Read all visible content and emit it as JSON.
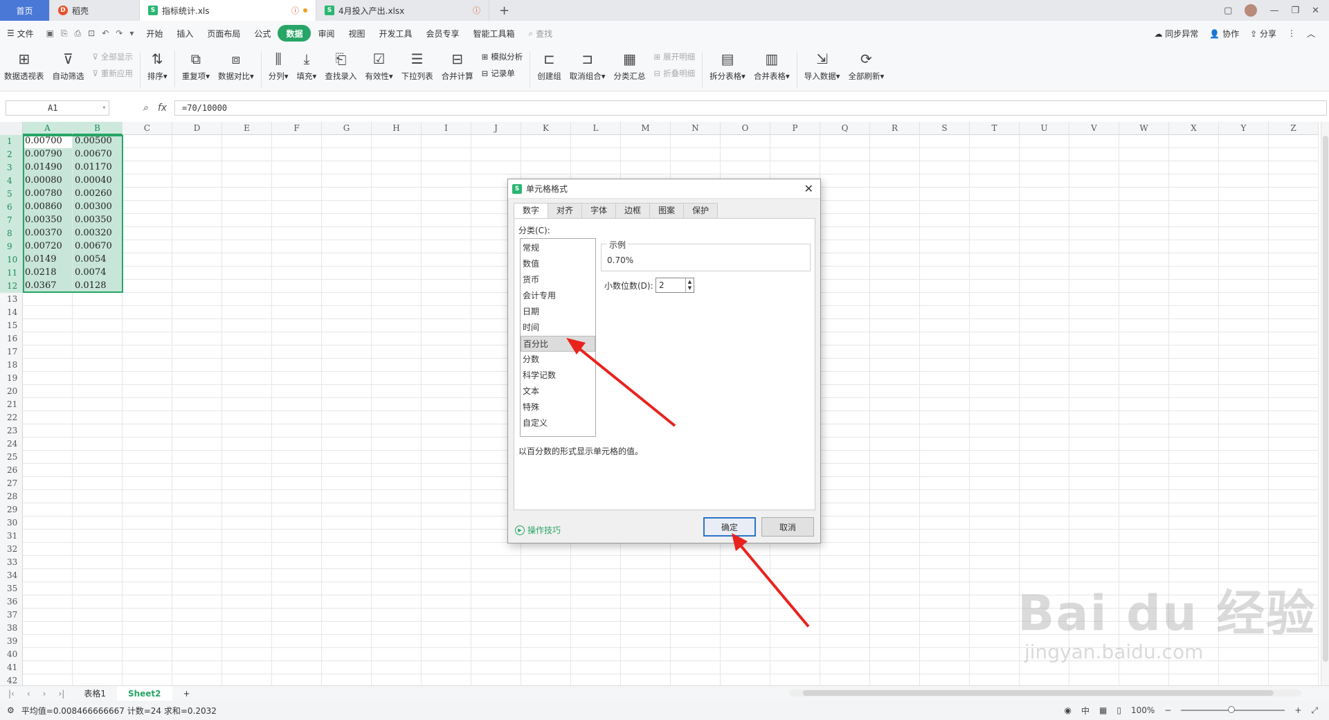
{
  "tabs": [
    {
      "label": "首页"
    },
    {
      "label": "稻壳"
    },
    {
      "label": "指标统计.xls"
    },
    {
      "label": "4月投入产出.xlsx"
    }
  ],
  "menu": {
    "file": "文件",
    "items": [
      "开始",
      "插入",
      "页面布局",
      "公式",
      "数据",
      "审阅",
      "视图",
      "开发工具",
      "会员专享",
      "智能工具箱"
    ],
    "search": "查找",
    "right": [
      "同步异常",
      "协作",
      "分享"
    ]
  },
  "ribbon": {
    "pivot": "数据透视表",
    "autofilter": "自动筛选",
    "showall": "全部显示",
    "reapply": "重新应用",
    "sort": "排序",
    "dup": "重复项",
    "compare": "数据对比",
    "split": "分列",
    "fill": "填充",
    "lookup": "查找录入",
    "validity": "有效性",
    "dropdown": "下拉列表",
    "merge_calc": "合并计算",
    "whatif": "模拟分析",
    "record": "记录单",
    "group": "创建组",
    "ungroup": "取消组合",
    "subtotal": "分类汇总",
    "expand": "展开明细",
    "collapse": "折叠明细",
    "split_table": "拆分表格",
    "merge_table": "合并表格",
    "import": "导入数据",
    "refresh": "全部刷新"
  },
  "formula_bar": {
    "name_box": "A1",
    "fx": "fx",
    "formula": "=70/10000"
  },
  "columns": [
    "A",
    "B",
    "C",
    "D",
    "E",
    "F",
    "G",
    "H",
    "I",
    "J",
    "K",
    "L",
    "M",
    "N",
    "O",
    "P",
    "Q",
    "R",
    "S",
    "T",
    "U",
    "V",
    "W",
    "X",
    "Y",
    "Z"
  ],
  "rows": [
    [
      "0.00700",
      "0.00500"
    ],
    [
      "0.00790",
      "0.00670"
    ],
    [
      "0.01490",
      "0.01170"
    ],
    [
      "0.00080",
      "0.00040"
    ],
    [
      "0.00780",
      "0.00260"
    ],
    [
      "0.00860",
      "0.00300"
    ],
    [
      "0.00350",
      "0.00350"
    ],
    [
      "0.00370",
      "0.00320"
    ],
    [
      "0.00720",
      "0.00670"
    ],
    [
      "0.0149",
      "0.0054"
    ],
    [
      "0.0218",
      "0.0074"
    ],
    [
      "0.0367",
      "0.0128"
    ]
  ],
  "row_count": 42,
  "sheets": [
    "表格1",
    "Sheet2"
  ],
  "status": {
    "text": "平均值=0.008466666667  计数=24  求和=0.2032",
    "zoom": "100%"
  },
  "dialog": {
    "title": "单元格格式",
    "tabs": [
      "数字",
      "对齐",
      "字体",
      "边框",
      "图案",
      "保护"
    ],
    "category_label": "分类(C):",
    "categories": [
      "常规",
      "数值",
      "货币",
      "会计专用",
      "日期",
      "时间",
      "百分比",
      "分数",
      "科学记数",
      "文本",
      "特殊",
      "自定义"
    ],
    "selected_index": 6,
    "sample_label": "示例",
    "sample_value": "0.70%",
    "decimal_label": "小数位数(D):",
    "decimal_value": "2",
    "description": "以百分数的形式显示单元格的值。",
    "tips": "操作技巧",
    "ok": "确定",
    "cancel": "取消"
  },
  "watermark": {
    "brand": "Bai du 经验",
    "url": "jingyan.baidu.com"
  },
  "colors": {
    "accent": "#27a566",
    "arrow": "#e8231e"
  }
}
